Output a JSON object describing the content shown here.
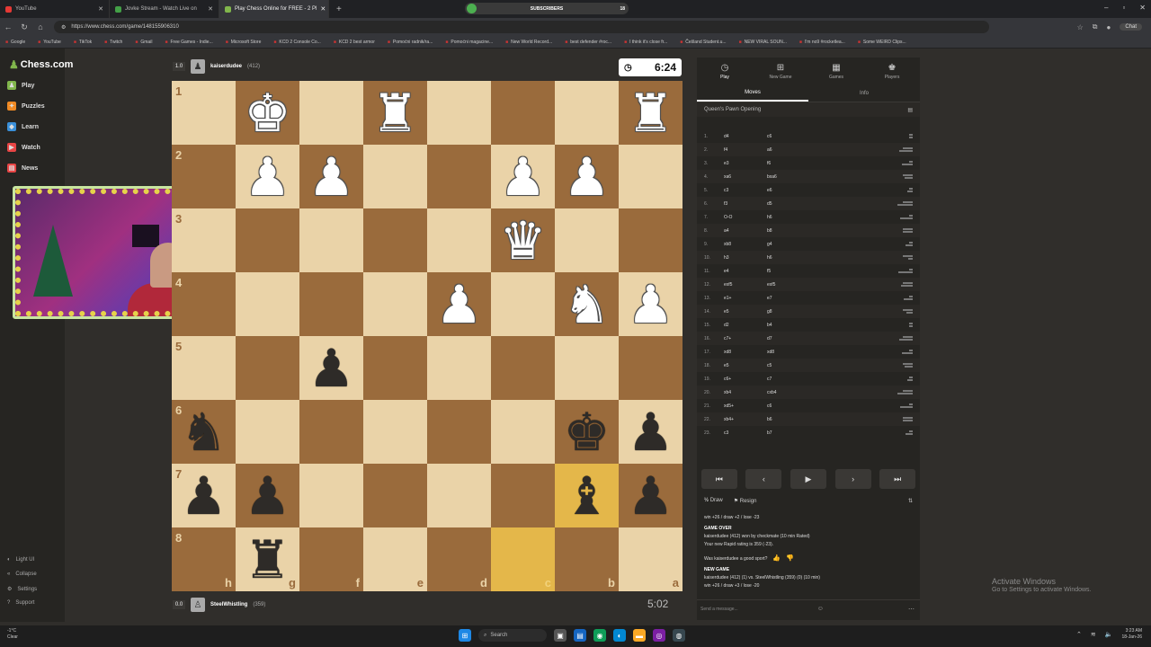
{
  "browser": {
    "tabs": [
      {
        "title": "YouTube",
        "color": "#e53935"
      },
      {
        "title": "Jovke Stream - Watch Live on",
        "color": "#43a047"
      },
      {
        "title": "Play Chess Online for FREE - 2 Pl",
        "color": "#81b64c"
      }
    ],
    "url": "https://www.chess.com/game/148155906310",
    "subscribers_label": "SUBSCRIBERS",
    "subscribers_count": "18",
    "chat_label": "Chat",
    "bookmarks": [
      "Google",
      "YouTube",
      "TikTok",
      "Twitch",
      "Gmail",
      "Free Games - Indie...",
      "Microsoft Store",
      "KCD 2 Console Co...",
      "KCD 2 best armor",
      "Pomoćni radnik/ra...",
      "Pomoćni magacine...",
      "New World Record...",
      "best defender #roc...",
      "I think it's close fr...",
      "Češland Student.u...",
      "NEW VIRAL SOUN...",
      "I'm no9 #rocketlea...",
      "Some WEIRD Clips..."
    ]
  },
  "sidebar": {
    "logo": "Chess.com",
    "items": [
      {
        "label": "Play",
        "color": "#81b64c"
      },
      {
        "label": "Puzzles",
        "color": "#f08a24"
      },
      {
        "label": "Learn",
        "color": "#3a8fd8"
      },
      {
        "label": "Watch",
        "color": "#e84545"
      },
      {
        "label": "News",
        "color": "#e84545"
      }
    ],
    "bottom": [
      "Light UI",
      "Collapse",
      "Settings",
      "Support"
    ]
  },
  "top_player": {
    "score": "1.0",
    "name": "kaiserdudee",
    "rating": "(412)",
    "clock": "6:24"
  },
  "bottom_player": {
    "score": "0.0",
    "name": "SteelWhistling",
    "rating": "(359)",
    "clock": "5:02"
  },
  "board": {
    "ranks": [
      "1",
      "2",
      "3",
      "4",
      "5",
      "6",
      "7",
      "8"
    ],
    "files": [
      "h",
      "g",
      "f",
      "e",
      "d",
      "c",
      "b",
      "a"
    ],
    "highlight": [
      "b7",
      "c8"
    ],
    "pieces": [
      [
        "",
        "wK",
        "",
        "wR",
        "",
        "",
        "",
        "wR"
      ],
      [
        "",
        "wP",
        "wP",
        "",
        "",
        "wP",
        "wP",
        ""
      ],
      [
        "",
        "",
        "",
        "",
        "",
        "wQ",
        "",
        ""
      ],
      [
        "",
        "",
        "",
        "",
        "wP",
        "",
        "wN",
        "wP"
      ],
      [
        "",
        "",
        "bP",
        "",
        "",
        "",
        "",
        ""
      ],
      [
        "bN",
        "",
        "",
        "",
        "",
        "",
        "bK",
        "bP"
      ],
      [
        "bP",
        "bP",
        "",
        "",
        "",
        "",
        "bB",
        "bP"
      ],
      [
        "",
        "bR",
        "",
        "",
        "",
        "",
        "",
        ""
      ]
    ]
  },
  "panel": {
    "tabs": [
      {
        "label": "Play",
        "icon": "timer-icon"
      },
      {
        "label": "New Game",
        "icon": "plus-icon"
      },
      {
        "label": "Games",
        "icon": "games-icon"
      },
      {
        "label": "Players",
        "icon": "players-icon"
      }
    ],
    "subtabs": [
      "Moves",
      "Info"
    ],
    "opening": "Queen's Pawn Opening",
    "moves": [
      [
        "1.",
        "d4",
        "c6"
      ],
      [
        "2.",
        "f4",
        "a6"
      ],
      [
        "3.",
        "e3",
        "f6"
      ],
      [
        "4.",
        "xa6",
        "bxa6"
      ],
      [
        "5.",
        "c3",
        "e6"
      ],
      [
        "6.",
        "f3",
        "d5"
      ],
      [
        "7.",
        "O-O",
        "h6"
      ],
      [
        "8.",
        "a4",
        "b8"
      ],
      [
        "9.",
        "xb8",
        "g4"
      ],
      [
        "10.",
        "h3",
        "h6"
      ],
      [
        "11.",
        "e4",
        "f5"
      ],
      [
        "12.",
        "exf5",
        "exf5"
      ],
      [
        "13.",
        "e1+",
        "e7"
      ],
      [
        "14.",
        "e5",
        "g8"
      ],
      [
        "15.",
        "d2",
        "b4"
      ],
      [
        "16.",
        "c7+",
        "d7"
      ],
      [
        "17.",
        "xd8",
        "xd8"
      ],
      [
        "18.",
        "e5",
        "c5"
      ],
      [
        "19.",
        "c6+",
        "c7"
      ],
      [
        "20.",
        "xb4",
        "cxb4"
      ],
      [
        "21.",
        "xd5+",
        "c6"
      ],
      [
        "22.",
        "xb4+",
        "b6"
      ],
      [
        "23.",
        "c3",
        "b7"
      ]
    ],
    "controls": [
      "⏮",
      "‹",
      "▶",
      "›",
      "⏭"
    ],
    "draw": "Draw",
    "resign": "Resign",
    "log": [
      "win +26 / draw +2 / lose -23",
      "GAME OVER",
      "kaiserdudee (412) won by checkmate (10 min Rated)",
      "Your new Rapid rating is 359 (-23).",
      "Was kaiserdudee a good sport?",
      "NEW GAME",
      "kaiserdudee (412) (1) vs. SteelWhistling (359) (0) (10 min)",
      "win +26 / draw +3 / lose -20"
    ],
    "send_placeholder": "Send a message..."
  },
  "activate": {
    "line1": "Activate Windows",
    "line2": "Go to Settings to activate Windows."
  },
  "taskbar": {
    "weather": "-1°C",
    "weather2": "Clear",
    "search": "Search",
    "time": "3:23 AM",
    "date": "18-Jan-26"
  }
}
